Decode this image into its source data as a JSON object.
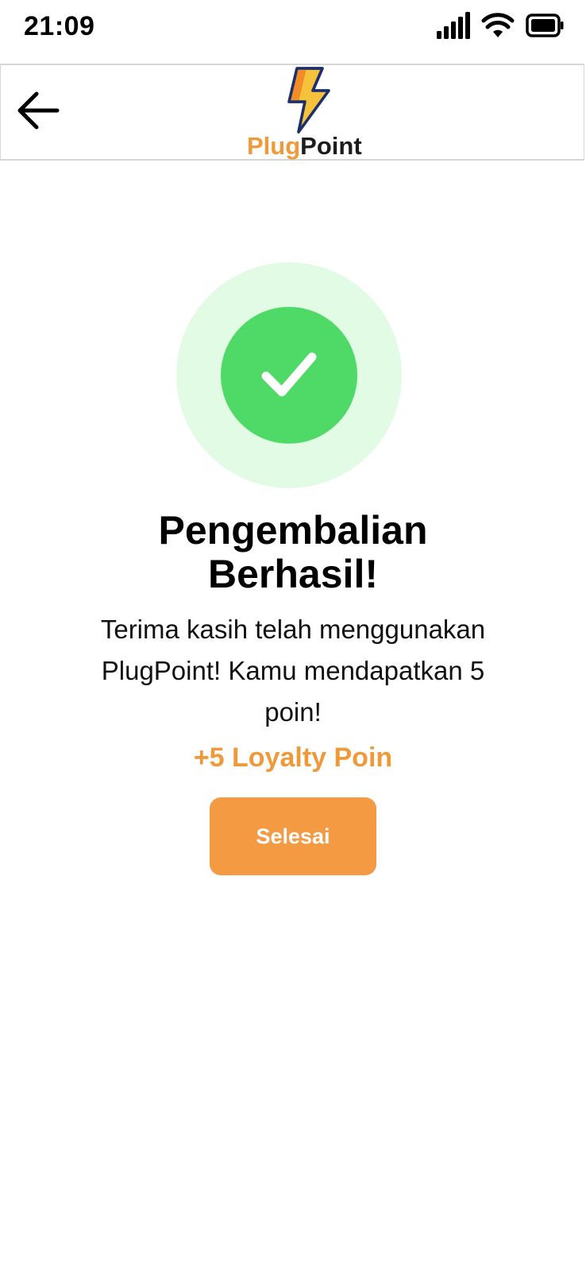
{
  "status_bar": {
    "time": "21:09",
    "icons": [
      "signal-icon",
      "wifi-icon",
      "battery-icon"
    ]
  },
  "header": {
    "back_icon": "arrow-left-icon",
    "logo": {
      "plug": "Plug",
      "point": "Point",
      "bolt_icon": "lightning-bolt-icon"
    }
  },
  "success": {
    "icon": "checkmark-icon",
    "title_line1": "Pengembalian",
    "title_line2": "Berhasil!",
    "message_line1": "Terima kasih telah menggunakan",
    "message_line2": "PlugPoint! Kamu mendapatkan 5",
    "message_line3": "poin!",
    "loyalty": "+5 Loyalty Poin",
    "button_label": "Selesai"
  },
  "colors": {
    "accent_orange": "#F39A42",
    "success_green": "#4FD966",
    "success_halo": "#E2FBE4",
    "bolt_yellow": "#F7C23B",
    "bolt_orange": "#F28C28",
    "bolt_outline": "#1C2F6B"
  }
}
